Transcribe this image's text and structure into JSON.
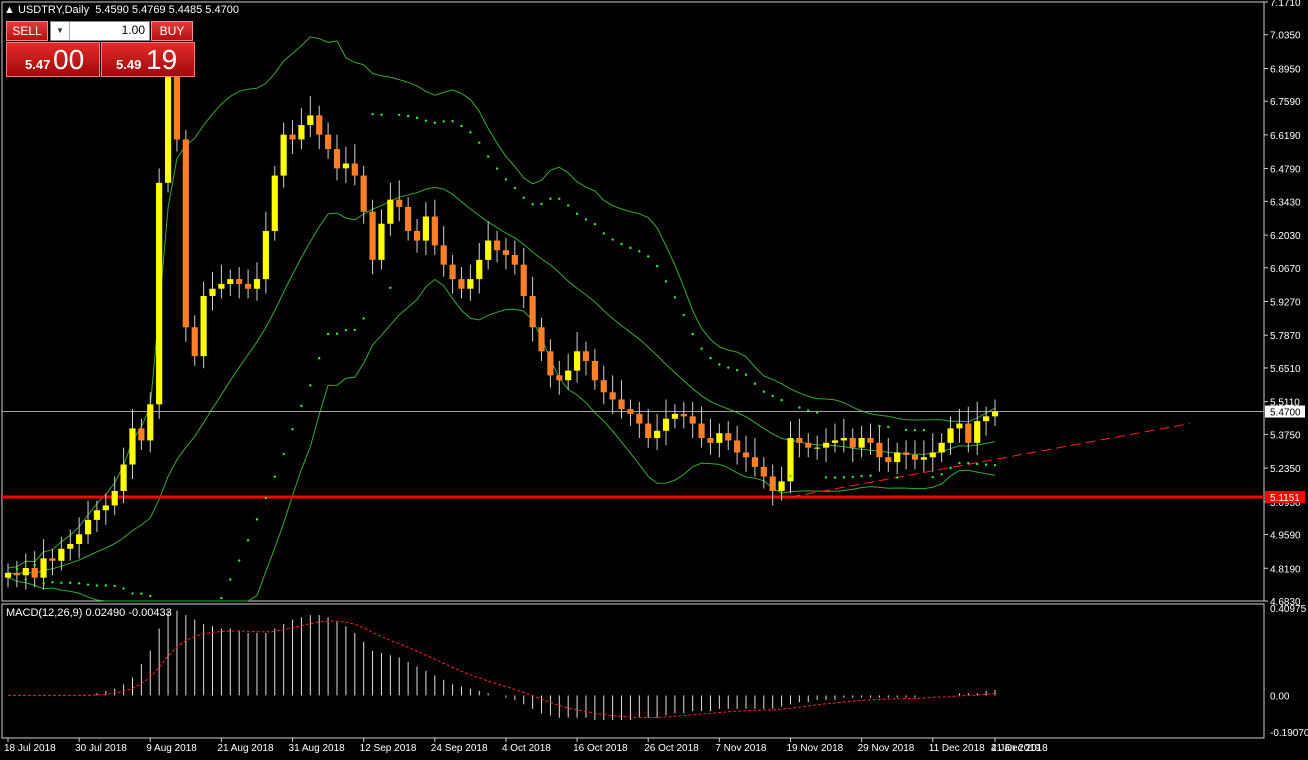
{
  "header": {
    "symbol": "USDTRY,Daily",
    "ohlc": "5.4590 5.4769 5.4485 5.4700"
  },
  "trade_panel": {
    "sell_label": "SELL",
    "buy_label": "BUY",
    "lot_value": "1.00",
    "sell_price_small": "5.47",
    "sell_price_big": "00",
    "buy_price_small": "5.49",
    "buy_price_big": "19"
  },
  "macd": {
    "label": "MACD(12,26,9) 0.02490 -0.00433"
  },
  "colors": {
    "bull": "#ffff00",
    "bear": "#ff7f27",
    "bands": "#33aa33",
    "sar": "#33ee33",
    "support": "#ff0000",
    "trend": "#ff2020",
    "signal": "#ff2020"
  },
  "chart_data": {
    "type": "candlestick",
    "symbol": "USDTRY",
    "timeframe": "Daily",
    "price_axis_ticks": [
      "7.1710",
      "7.0350",
      "6.8950",
      "6.7590",
      "6.6190",
      "6.4790",
      "6.3430",
      "6.2030",
      "6.0670",
      "5.9270",
      "5.7870",
      "5.6510",
      "5.5110",
      "5.3750",
      "5.2350",
      "5.0950",
      "4.9590",
      "4.8190",
      "4.6830"
    ],
    "macd_axis_ticks": [
      "0.40975",
      "0.00",
      "-0.19070"
    ],
    "date_ticks": [
      "18 Jul 2018",
      "30 Jul 2018",
      "9 Aug 2018",
      "21 Aug 2018",
      "31 Aug 2018",
      "12 Sep 2018",
      "24 Sep 2018",
      "4 Oct 2018",
      "16 Oct 2018",
      "26 Oct 2018",
      "7 Nov 2018",
      "19 Nov 2018",
      "29 Nov 2018",
      "11 Dec 2018",
      "21 Dec 2018",
      "4 Jan 2019"
    ],
    "current_price": "5.4700",
    "support_level": "5.1151",
    "ylim": [
      4.683,
      7.171
    ],
    "macd_ylim": [
      -0.1907,
      0.40975
    ],
    "close_approx": [
      4.8,
      4.79,
      4.82,
      4.78,
      4.86,
      4.85,
      4.9,
      4.92,
      4.96,
      5.02,
      5.06,
      5.08,
      5.14,
      5.25,
      5.4,
      5.35,
      5.5,
      6.42,
      6.9,
      6.6,
      5.82,
      5.7,
      5.95,
      5.98,
      6.0,
      6.02,
      6.0,
      5.98,
      6.02,
      6.22,
      6.45,
      6.62,
      6.6,
      6.66,
      6.7,
      6.62,
      6.56,
      6.48,
      6.5,
      6.45,
      6.3,
      6.1,
      6.25,
      6.35,
      6.32,
      6.22,
      6.18,
      6.28,
      6.16,
      6.08,
      6.02,
      5.98,
      6.02,
      6.1,
      6.18,
      6.14,
      6.12,
      6.08,
      5.95,
      5.82,
      5.72,
      5.62,
      5.6,
      5.64,
      5.72,
      5.68,
      5.6,
      5.55,
      5.52,
      5.48,
      5.46,
      5.42,
      5.36,
      5.39,
      5.44,
      5.46,
      5.45,
      5.42,
      5.36,
      5.34,
      5.38,
      5.35,
      5.3,
      5.28,
      5.24,
      5.2,
      5.14,
      5.18,
      5.36,
      5.34,
      5.32,
      5.32,
      5.34,
      5.35,
      5.36,
      5.32,
      5.36,
      5.34,
      5.28,
      5.26,
      5.3,
      5.29,
      5.27,
      5.28,
      5.3,
      5.34,
      5.4,
      5.42,
      5.34,
      5.43,
      5.45,
      5.47
    ],
    "macd_hist_approx": [
      0.0,
      0.0,
      0.0,
      0.0,
      0.0,
      0.0,
      0.0,
      0.0,
      0.0,
      0.0,
      0.01,
      0.02,
      0.03,
      0.05,
      0.08,
      0.14,
      0.2,
      0.3,
      0.38,
      0.38,
      0.36,
      0.34,
      0.32,
      0.31,
      0.3,
      0.3,
      0.29,
      0.28,
      0.28,
      0.28,
      0.3,
      0.32,
      0.34,
      0.35,
      0.36,
      0.36,
      0.35,
      0.33,
      0.31,
      0.28,
      0.24,
      0.2,
      0.19,
      0.18,
      0.17,
      0.15,
      0.13,
      0.11,
      0.09,
      0.07,
      0.05,
      0.04,
      0.03,
      0.02,
      0.01,
      0.0,
      -0.01,
      -0.02,
      -0.04,
      -0.06,
      -0.08,
      -0.09,
      -0.1,
      -0.1,
      -0.1,
      -0.1,
      -0.11,
      -0.11,
      -0.11,
      -0.11,
      -0.11,
      -0.1,
      -0.1,
      -0.1,
      -0.09,
      -0.08,
      -0.08,
      -0.07,
      -0.07,
      -0.07,
      -0.06,
      -0.06,
      -0.06,
      -0.06,
      -0.06,
      -0.06,
      -0.06,
      -0.05,
      -0.04,
      -0.03,
      -0.03,
      -0.02,
      -0.02,
      -0.02,
      -0.01,
      -0.01,
      -0.01,
      -0.01,
      -0.01,
      -0.01,
      -0.01,
      -0.01,
      -0.01,
      0.0,
      0.0,
      0.0,
      0.0,
      0.01,
      0.01,
      0.01,
      0.02,
      0.025
    ]
  }
}
